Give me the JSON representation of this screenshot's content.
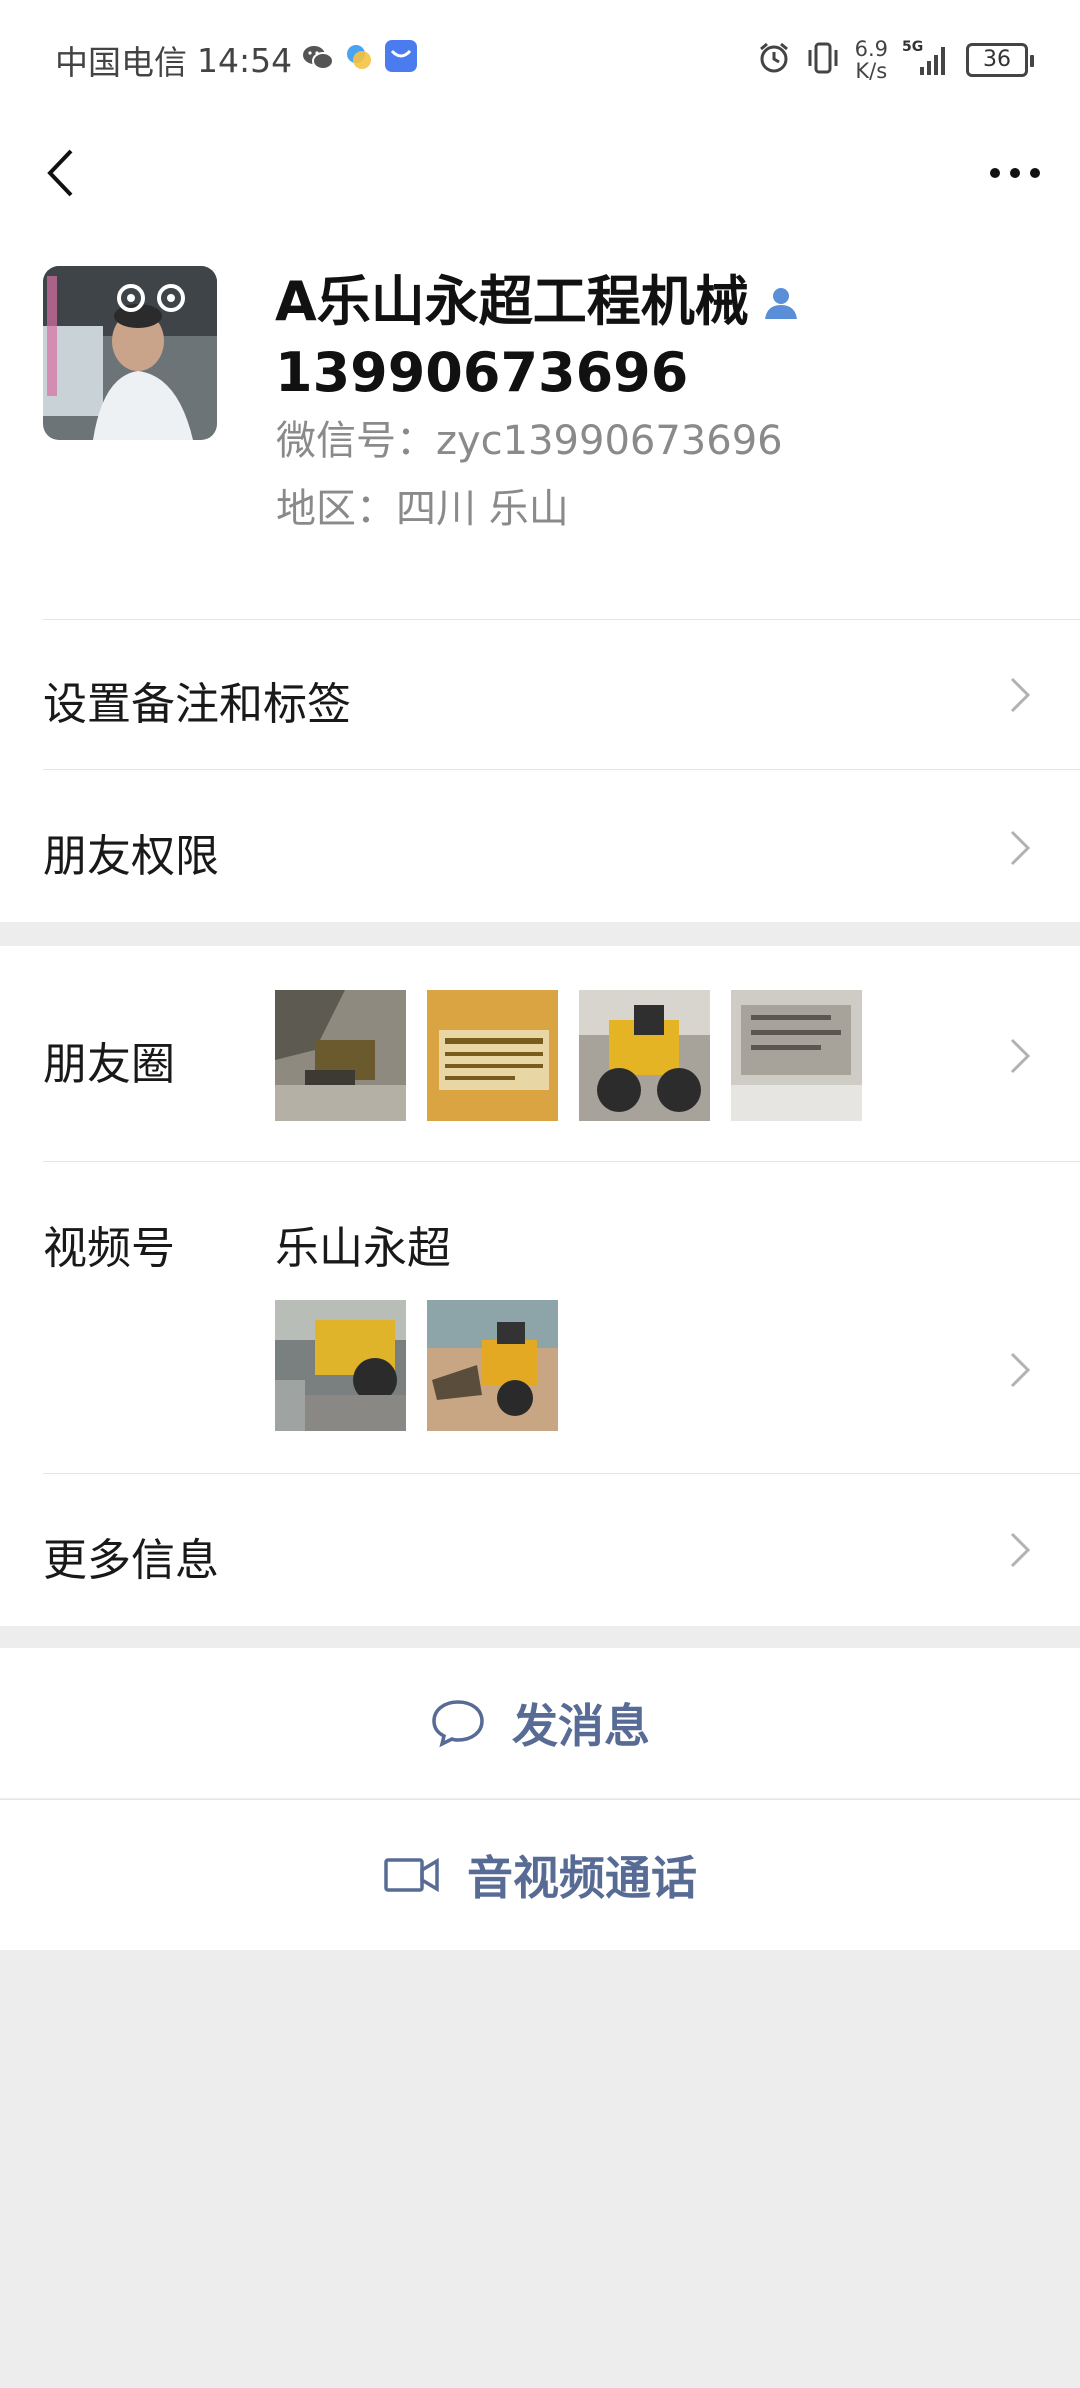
{
  "status_bar": {
    "carrier": "中国电信",
    "time": "14:54",
    "net_speed_value": "6.9",
    "net_speed_unit": "K/s",
    "network": "5G",
    "battery": "36"
  },
  "profile": {
    "name_line1": "A乐山永超工程机械",
    "name_line2": "13990673696",
    "wechat_id": "微信号：zyc13990673696",
    "region": "地区：四川  乐山"
  },
  "rows": {
    "remark_label": "设置备注和标签",
    "permissions_label": "朋友权限",
    "moments_label": "朋友圈",
    "channels_label": "视频号",
    "channels_name": "乐山永超",
    "more_info_label": "更多信息"
  },
  "actions": {
    "message_label": "发消息",
    "call_label": "音视频通话"
  },
  "colors": {
    "accent_link": "#576b95",
    "background": "#ededed"
  }
}
